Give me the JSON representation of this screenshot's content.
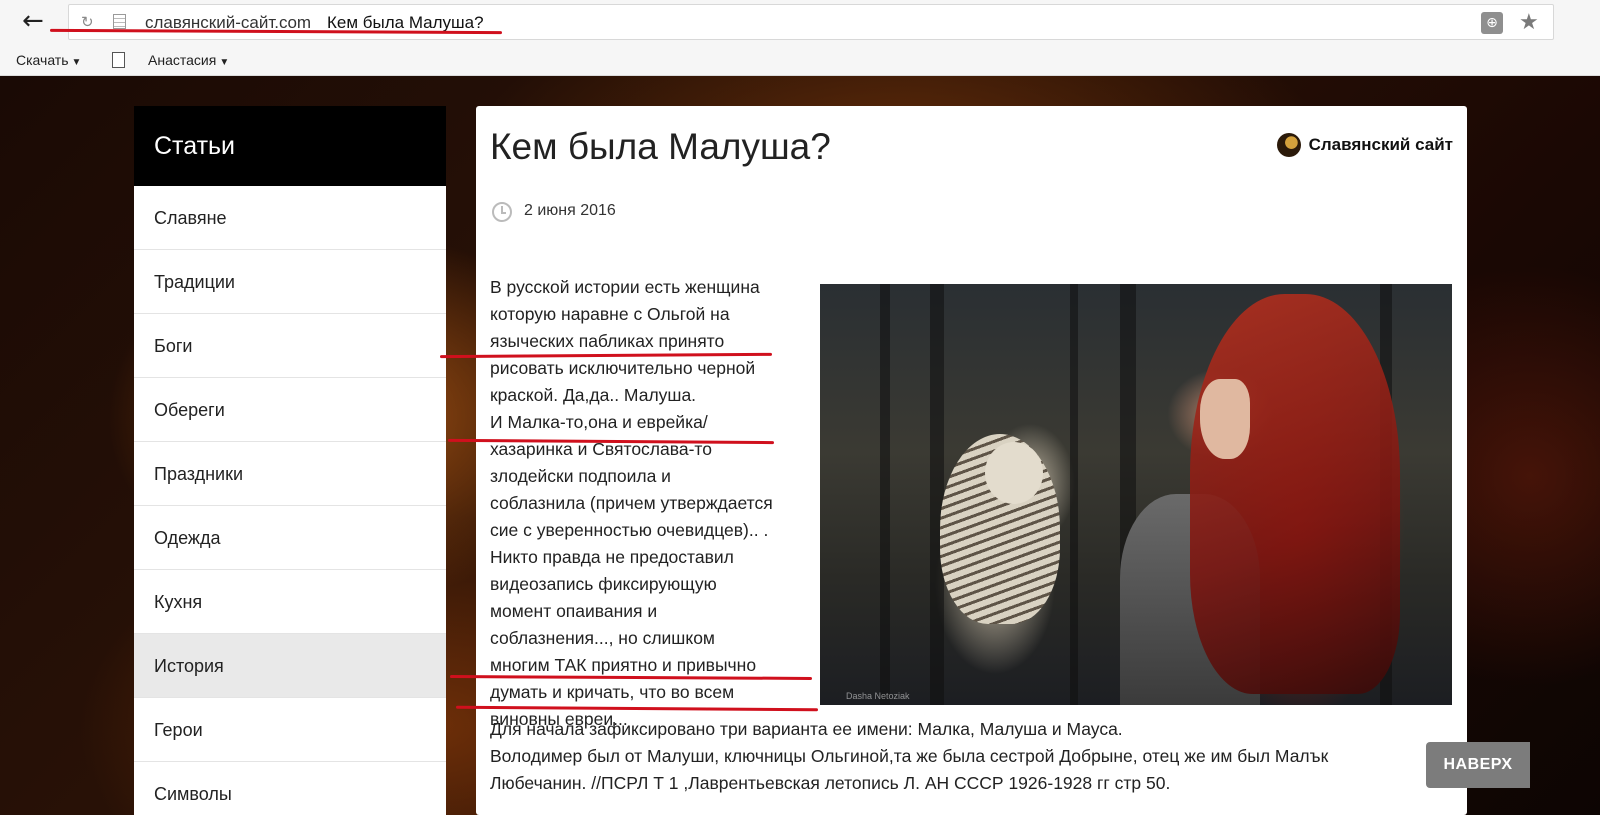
{
  "browser": {
    "url_domain": "славянский-сайт.com",
    "url_title": "Кем была Малуша?",
    "back_icon": "←",
    "reload_icon": "↻",
    "ext_icon": "⊕",
    "star_icon": "★"
  },
  "bookmarks": {
    "download_label": "Скачать",
    "user_label": "Анастасия",
    "caret": "▼"
  },
  "sidebar": {
    "heading": "Статьи",
    "items": [
      {
        "label": "Славяне"
      },
      {
        "label": "Традиции"
      },
      {
        "label": "Боги"
      },
      {
        "label": "Обереги"
      },
      {
        "label": "Праздники"
      },
      {
        "label": "Одежда"
      },
      {
        "label": "Кухня"
      },
      {
        "label": "История",
        "active": true
      },
      {
        "label": "Герои"
      },
      {
        "label": "Символы"
      }
    ]
  },
  "article": {
    "title": "Кем была Малуша?",
    "site_name": "Славянский сайт",
    "date": "2 июня 2016",
    "photo_credit": "Dasha Netoziak",
    "column_lines": [
      "В русской истории есть женщина",
      "которую наравне с Ольгой на",
      "языческих пабликах принято",
      "рисовать исключительно черной",
      "краской. Да,да.. Малуша.",
      "И Малка-то,она и еврейка/",
      "хазаринка и Святослава-то",
      "злодейски подпоила и",
      "соблазнила (причем утверждается",
      "сие с уверенностью очевидцев).. .",
      "Никто правда не предоставил",
      "видеозапись фиксирующую",
      "момент опаивания и",
      "соблазнения..., но слишком",
      "многим ТАК приятно и привычно",
      "думать и кричать, что во всем",
      "виновны евреи..."
    ],
    "full_lines": [
      "Для начала зафиксировано три варианта ее имени: Малка, Малуша и Мауса.",
      "Володимер был от Малуши, ключницы Ольгиной,та же была сестрой Добрыне, отец же им был Малък",
      "Любечанин. //ПСРЛ Т 1 ,Лаврентьевская летопись Л. АН СССР 1926-1928 гг стр 50."
    ]
  },
  "to_top_label": "НАВЕРХ",
  "colors": {
    "annotation": "#d0101d",
    "sidebar_header": "#000000",
    "active_item": "#e9e9e9"
  }
}
